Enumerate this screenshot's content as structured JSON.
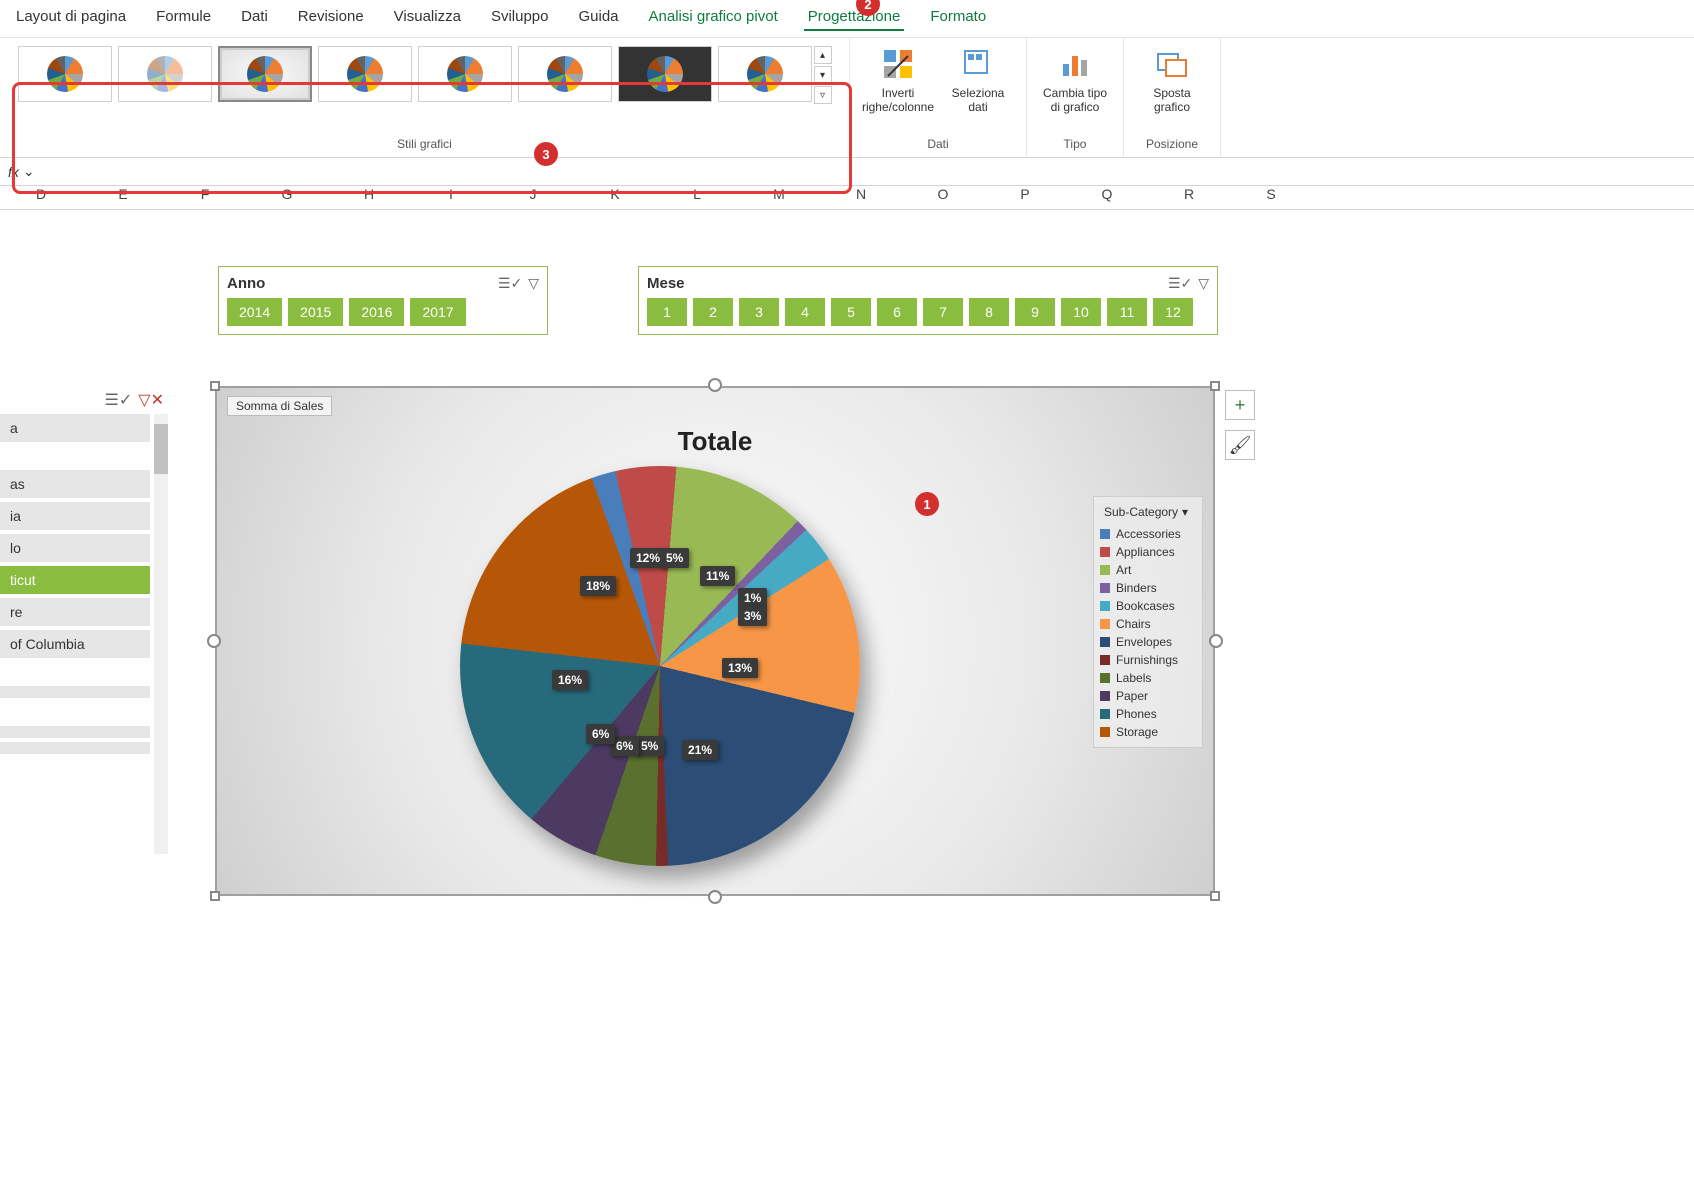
{
  "ribbon_tabs": {
    "layout": "Layout di pagina",
    "formule": "Formule",
    "dati": "Dati",
    "revisione": "Revisione",
    "visualizza": "Visualizza",
    "sviluppo": "Sviluppo",
    "guida": "Guida",
    "analisi": "Analisi grafico pivot",
    "progettazione": "Progettazione",
    "formato": "Formato"
  },
  "ribbon_groups": {
    "stili": "Stili grafici",
    "dati": "Dati",
    "tipo": "Tipo",
    "posizione": "Posizione"
  },
  "ribbon_buttons": {
    "inverti": "Inverti righe/colonne",
    "seleziona": "Seleziona dati",
    "cambia": "Cambia tipo di grafico",
    "sposta": "Sposta grafico"
  },
  "badges": {
    "b1": "1",
    "b2": "2",
    "b3": "3"
  },
  "formula_bar": {
    "fx": "fx"
  },
  "columns": [
    "D",
    "E",
    "F",
    "G",
    "H",
    "I",
    "J",
    "K",
    "L",
    "M",
    "N",
    "O",
    "P",
    "Q",
    "R",
    "S"
  ],
  "slicers": {
    "anno": {
      "title": "Anno",
      "items": [
        "2014",
        "2015",
        "2016",
        "2017"
      ]
    },
    "mese": {
      "title": "Mese",
      "items": [
        "1",
        "2",
        "3",
        "4",
        "5",
        "6",
        "7",
        "8",
        "9",
        "10",
        "11",
        "12"
      ]
    },
    "state": {
      "items_partial": [
        "a",
        "as",
        "ia",
        "lo",
        "ticut",
        "re",
        "of Columbia",
        ""
      ],
      "selected_index": 4
    }
  },
  "chart": {
    "field_button": "Somma di Sales",
    "title": "Totale",
    "legend_header": "Sub-Category",
    "legend": [
      {
        "label": "Accessories",
        "color": "#4a7ebb"
      },
      {
        "label": "Appliances",
        "color": "#be4b48"
      },
      {
        "label": "Art",
        "color": "#98b954"
      },
      {
        "label": "Binders",
        "color": "#7d60a0"
      },
      {
        "label": "Bookcases",
        "color": "#46aac5"
      },
      {
        "label": "Chairs",
        "color": "#f79646"
      },
      {
        "label": "Envelopes",
        "color": "#2c4d75"
      },
      {
        "label": "Furnishings",
        "color": "#772c2a"
      },
      {
        "label": "Labels",
        "color": "#5a702f"
      },
      {
        "label": "Paper",
        "color": "#4c3a63"
      },
      {
        "label": "Phones",
        "color": "#276a7c"
      },
      {
        "label": "Storage",
        "color": "#b65708"
      }
    ],
    "data_labels": [
      "12%",
      "5%",
      "11%",
      "1%",
      "3%",
      "13%",
      "21%",
      "5%",
      "6%",
      "6%",
      "16%",
      "18%"
    ]
  },
  "chart_data": {
    "type": "pie",
    "title": "Totale",
    "series_name": "Somma di Sales",
    "categories": [
      "Accessories",
      "Appliances",
      "Art",
      "Binders",
      "Bookcases",
      "Chairs",
      "Envelopes",
      "Furnishings",
      "Labels",
      "Paper",
      "Phones",
      "Storage"
    ],
    "values_pct": [
      2,
      5,
      11,
      1,
      3,
      13,
      21,
      1,
      5,
      6,
      16,
      18
    ],
    "colors": [
      "#4a7ebb",
      "#be4b48",
      "#98b954",
      "#7d60a0",
      "#46aac5",
      "#f79646",
      "#2c4d75",
      "#772c2a",
      "#5a702f",
      "#4c3a63",
      "#276a7c",
      "#b65708"
    ]
  },
  "chart_tools": {
    "plus": "+",
    "brush": "🖌"
  }
}
